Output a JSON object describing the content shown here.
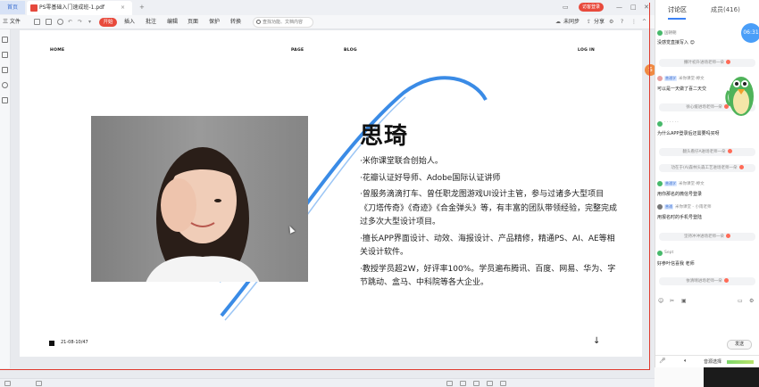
{
  "titlebar": {
    "home_tab": "首页",
    "doc_tab": "PS零基础入门速成班-1.pdf",
    "new_tab": "+",
    "login_button": "访客登录",
    "controls": [
      "—",
      "□",
      "✕"
    ]
  },
  "toolbar": {
    "menu": "三 文件",
    "start": "开始",
    "items": [
      "插入",
      "批注",
      "编辑",
      "页面",
      "保护",
      "转换"
    ],
    "search_placeholder": "查找功能、文档内容",
    "sync": "未同步",
    "share": "分享"
  },
  "page": {
    "nav": {
      "home": "HOME",
      "page": "PAGE",
      "blog": "BLOG",
      "login": "LOG IN"
    },
    "name": "思琦",
    "bio": [
      "·米你课堂联合创始人。",
      "·花瓣认证好导师、Adobe国际认证讲师",
      "·曾服务滴滴打车、曾任职龙图游戏UI设计主管，参与过诸多大型项目《刀塔传奇》《奇迹》《合金弹头》等，有丰富的团队带领经验，完整完成过多次大型设计项目。",
      "·擅长APP界面设计、动效、海报设计、产品精修，精通PS、AI、AE等相关设计软件。",
      "·教授学员超2W，好评率100%。学员遍布腾讯、百度、网易、华为、字节跳动、盒马、中科院等各大企业。"
    ],
    "footer_date": "21-08-10/47",
    "down_arrow": "↓"
  },
  "panel": {
    "tabs": [
      "讨论区",
      "成员(416)"
    ],
    "timer": "06:31",
    "messages": [
      {
        "name": "国朝朝",
        "text": "没感觉直接写入 😊"
      },
      {
        "notice": "撒叶初升进场老师一朵"
      },
      {
        "tag": "普通学",
        "name": "米你课堂-婷文",
        "text": "可以是一天做了喜二天交"
      },
      {
        "notice": "徐心缓进场老师一朵"
      },
      {
        "name": "· · · · · ·",
        "text": "为什么APP登录后还需要吗买呀"
      },
      {
        "notice": "翻头看仔A进场老师一朵"
      },
      {
        "notice": "功在于(A)森林头森工艺进场老师一朵"
      },
      {
        "tag": "普通学",
        "name": "米你课堂-婷文",
        "text": "用你那名的微信号登录"
      },
      {
        "tag": "普通",
        "name": "米你课堂 - 小雨老师",
        "text": "用报名时的手机号登陆"
      },
      {
        "notice": "坚持冲冲进场老师一朵"
      },
      {
        "name": "Sept",
        "text": "好参叶信喜我 老师"
      },
      {
        "notice": "依清晴进场老师一朵"
      }
    ],
    "send": "发送",
    "footer_label": "音源选择"
  },
  "colors": {
    "accent_red": "#e84a3c",
    "curve_blue": "#3a8be6",
    "panel_blue": "#3b82f6"
  }
}
